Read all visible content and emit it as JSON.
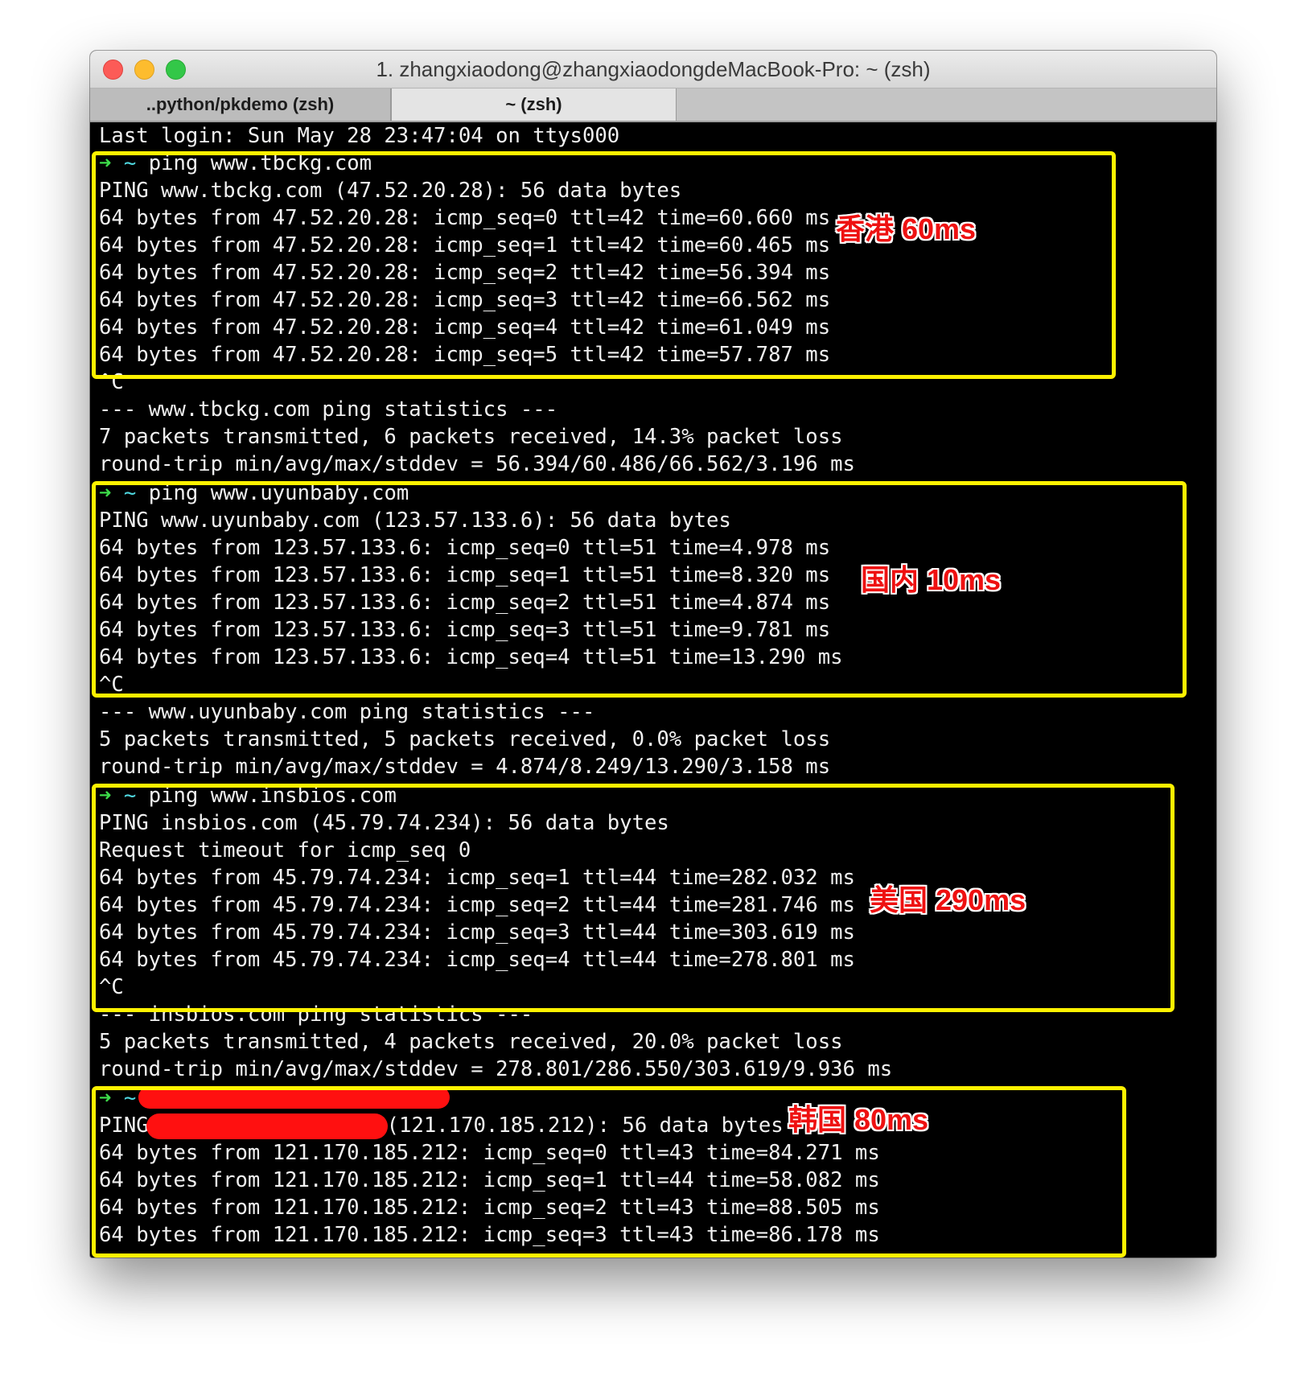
{
  "window": {
    "title": "1. zhangxiaodong@zhangxiaodongdeMacBook-Pro: ~ (zsh)",
    "tabs": [
      {
        "label": "..python/pkdemo (zsh)"
      },
      {
        "label": "~ (zsh)"
      }
    ]
  },
  "terminal": {
    "last_login": "Last login: Sun May 28 23:47:04 on ttys000",
    "prompt_arrow": "➜",
    "prompt_dir": "~",
    "blocks": [
      {
        "command": "ping www.tbckg.com",
        "header": "PING www.tbckg.com (47.52.20.28): 56 data bytes",
        "replies": [
          "64 bytes from 47.52.20.28: icmp_seq=0 ttl=42 time=60.660 ms",
          "64 bytes from 47.52.20.28: icmp_seq=1 ttl=42 time=60.465 ms",
          "64 bytes from 47.52.20.28: icmp_seq=2 ttl=42 time=56.394 ms",
          "64 bytes from 47.52.20.28: icmp_seq=3 ttl=42 time=66.562 ms",
          "64 bytes from 47.52.20.28: icmp_seq=4 ttl=42 time=61.049 ms",
          "64 bytes from 47.52.20.28: icmp_seq=5 ttl=42 time=57.787 ms"
        ],
        "interrupt": "^C",
        "stats_header": "--- www.tbckg.com ping statistics ---",
        "stats_packets": "7 packets transmitted, 6 packets received, 14.3% packet loss",
        "stats_rtt": "round-trip min/avg/max/stddev = 56.394/60.486/66.562/3.196 ms",
        "annotation": "香港 60ms"
      },
      {
        "command": "ping www.uyunbaby.com",
        "header": "PING www.uyunbaby.com (123.57.133.6): 56 data bytes",
        "replies": [
          "64 bytes from 123.57.133.6: icmp_seq=0 ttl=51 time=4.978 ms",
          "64 bytes from 123.57.133.6: icmp_seq=1 ttl=51 time=8.320 ms",
          "64 bytes from 123.57.133.6: icmp_seq=2 ttl=51 time=4.874 ms",
          "64 bytes from 123.57.133.6: icmp_seq=3 ttl=51 time=9.781 ms",
          "64 bytes from 123.57.133.6: icmp_seq=4 ttl=51 time=13.290 ms"
        ],
        "interrupt": "^C",
        "stats_header": "--- www.uyunbaby.com ping statistics ---",
        "stats_packets": "5 packets transmitted, 5 packets received, 0.0% packet loss",
        "stats_rtt": "round-trip min/avg/max/stddev = 4.874/8.249/13.290/3.158 ms",
        "annotation": "国内 10ms"
      },
      {
        "command": "ping www.insbios.com",
        "header": "PING insbios.com (45.79.74.234): 56 data bytes",
        "timeout": "Request timeout for icmp_seq 0",
        "replies": [
          "64 bytes from 45.79.74.234: icmp_seq=1 ttl=44 time=282.032 ms",
          "64 bytes from 45.79.74.234: icmp_seq=2 ttl=44 time=281.746 ms",
          "64 bytes from 45.79.74.234: icmp_seq=3 ttl=44 time=303.619 ms",
          "64 bytes from 45.79.74.234: icmp_seq=4 ttl=44 time=278.801 ms"
        ],
        "interrupt": "^C",
        "stats_header": "--- insbios.com ping statistics ---",
        "stats_packets": "5 packets transmitted, 4 packets received, 20.0% packet loss",
        "stats_rtt": "round-trip min/avg/max/stddev = 278.801/286.550/303.619/9.936 ms",
        "annotation": "美国 290ms"
      },
      {
        "header_prefix": "PING",
        "header_suffix": "(121.170.185.212): 56 data bytes",
        "replies": [
          "64 bytes from 121.170.185.212: icmp_seq=0 ttl=43 time=84.271 ms",
          "64 bytes from 121.170.185.212: icmp_seq=1 ttl=44 time=58.082 ms",
          "64 bytes from 121.170.185.212: icmp_seq=2 ttl=43 time=88.505 ms",
          "64 bytes from 121.170.185.212: icmp_seq=3 ttl=43 time=86.178 ms"
        ],
        "annotation": "韩国 80ms"
      }
    ]
  },
  "colors": {
    "highlight_box": "#fff200",
    "annotation_text": "#ee1111",
    "redaction": "#ff1010",
    "prompt_arrow": "#3ddc4a",
    "terminal_bg": "#000000"
  }
}
